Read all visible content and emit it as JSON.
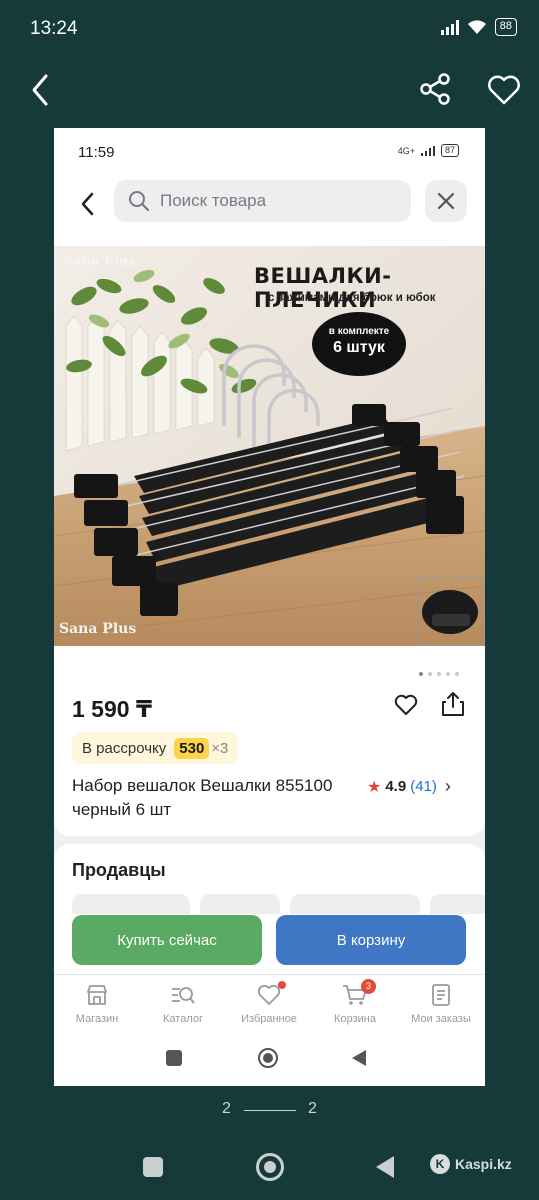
{
  "outer": {
    "time": "13:24",
    "battery": "88"
  },
  "inner": {
    "time": "11:59",
    "network": "4G+",
    "battery": "87",
    "search_placeholder": "Поиск товара"
  },
  "image": {
    "title": "ВЕШАЛКИ-ПЛЕЧИКИ",
    "subtitle": "с зажимами для брюк и юбок",
    "kit_line1": "в комплекте",
    "kit_line2": "6 штук",
    "brand": "Sana Plus"
  },
  "product": {
    "price": "1 590 ₸",
    "installment_label": "В рассрочку",
    "installment_amount": "530",
    "installment_times": "×3",
    "title": "Набор вешалок Вешалки 855100 черный 6 шт",
    "rating": "4.9",
    "reviews": "(41)"
  },
  "sellers": {
    "title": "Продавцы"
  },
  "actions": {
    "buy_now": "Купить сейчас",
    "to_cart": "В корзину"
  },
  "tabs": [
    {
      "label": "Магазин",
      "icon": "shop-icon"
    },
    {
      "label": "Каталог",
      "icon": "catalog-icon"
    },
    {
      "label": "Избранное",
      "icon": "heart-icon"
    },
    {
      "label": "Корзина",
      "icon": "cart-icon",
      "badge": "3"
    },
    {
      "label": "Мои заказы",
      "icon": "orders-icon"
    }
  ],
  "pager": {
    "current": "2",
    "total": "2"
  },
  "watermark": "Kaspi.kz",
  "colors": {
    "background": "#163a3a",
    "buy_button": "#5aaa63",
    "cart_button": "#3f77c4",
    "installment_bg": "#fff6dc",
    "installment_amount_bg": "#fcd34a",
    "rating_star": "#e04545",
    "reviews_link": "#1a6fd6",
    "badge": "#e34a3a"
  }
}
